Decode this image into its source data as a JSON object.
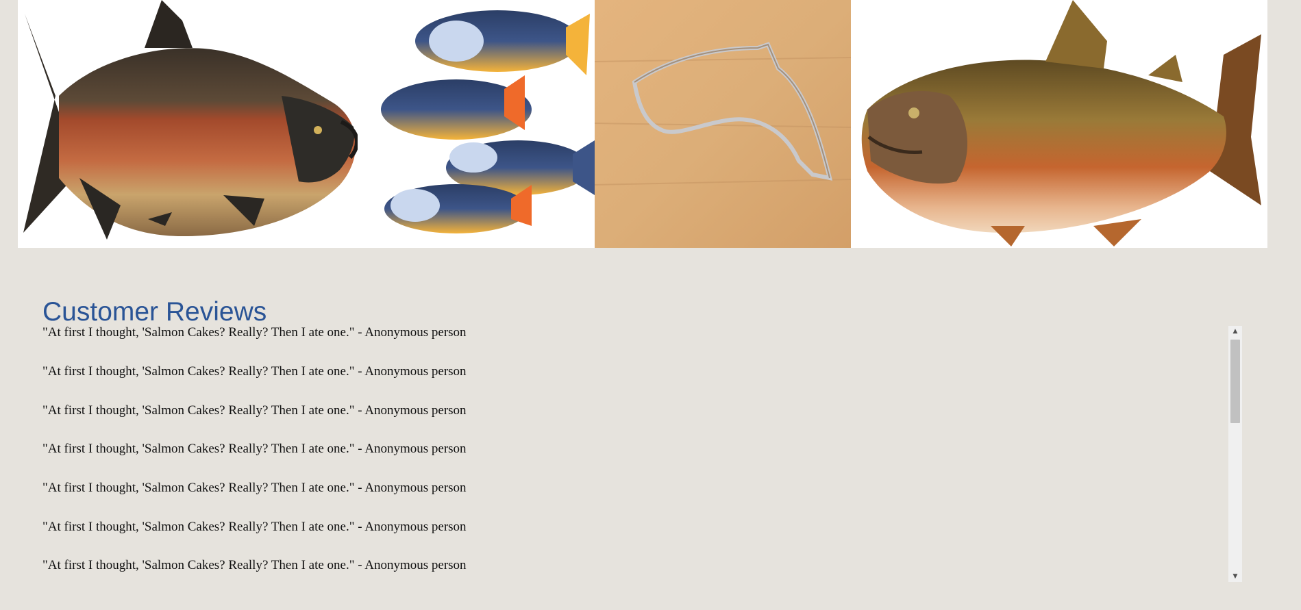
{
  "banner": {
    "images": [
      {
        "name": "sockeye-salmon-illustration"
      },
      {
        "name": "painted-fish-cookies"
      },
      {
        "name": "fish-cookie-cutter"
      },
      {
        "name": "chinook-salmon-illustration"
      }
    ]
  },
  "reviews": {
    "title": "Customer Reviews",
    "items": [
      {
        "text": "\"At first I thought, 'Salmon Cakes? Really? Then I ate one.\" - Anonymous person"
      },
      {
        "text": "\"At first I thought, 'Salmon Cakes? Really? Then I ate one.\" - Anonymous person"
      },
      {
        "text": "\"At first I thought, 'Salmon Cakes? Really? Then I ate one.\" - Anonymous person"
      },
      {
        "text": "\"At first I thought, 'Salmon Cakes? Really? Then I ate one.\" - Anonymous person"
      },
      {
        "text": "\"At first I thought, 'Salmon Cakes? Really? Then I ate one.\" - Anonymous person"
      },
      {
        "text": "\"At first I thought, 'Salmon Cakes? Really? Then I ate one.\" - Anonymous person"
      },
      {
        "text": "\"At first I thought, 'Salmon Cakes? Really? Then I ate one.\" - Anonymous person"
      }
    ]
  },
  "scrollbar": {
    "up_icon": "arrow-up-icon",
    "down_icon": "arrow-down-icon"
  },
  "colors": {
    "page_background": "#e6e3dd",
    "title": "#2a5496",
    "review_text": "#111111"
  }
}
